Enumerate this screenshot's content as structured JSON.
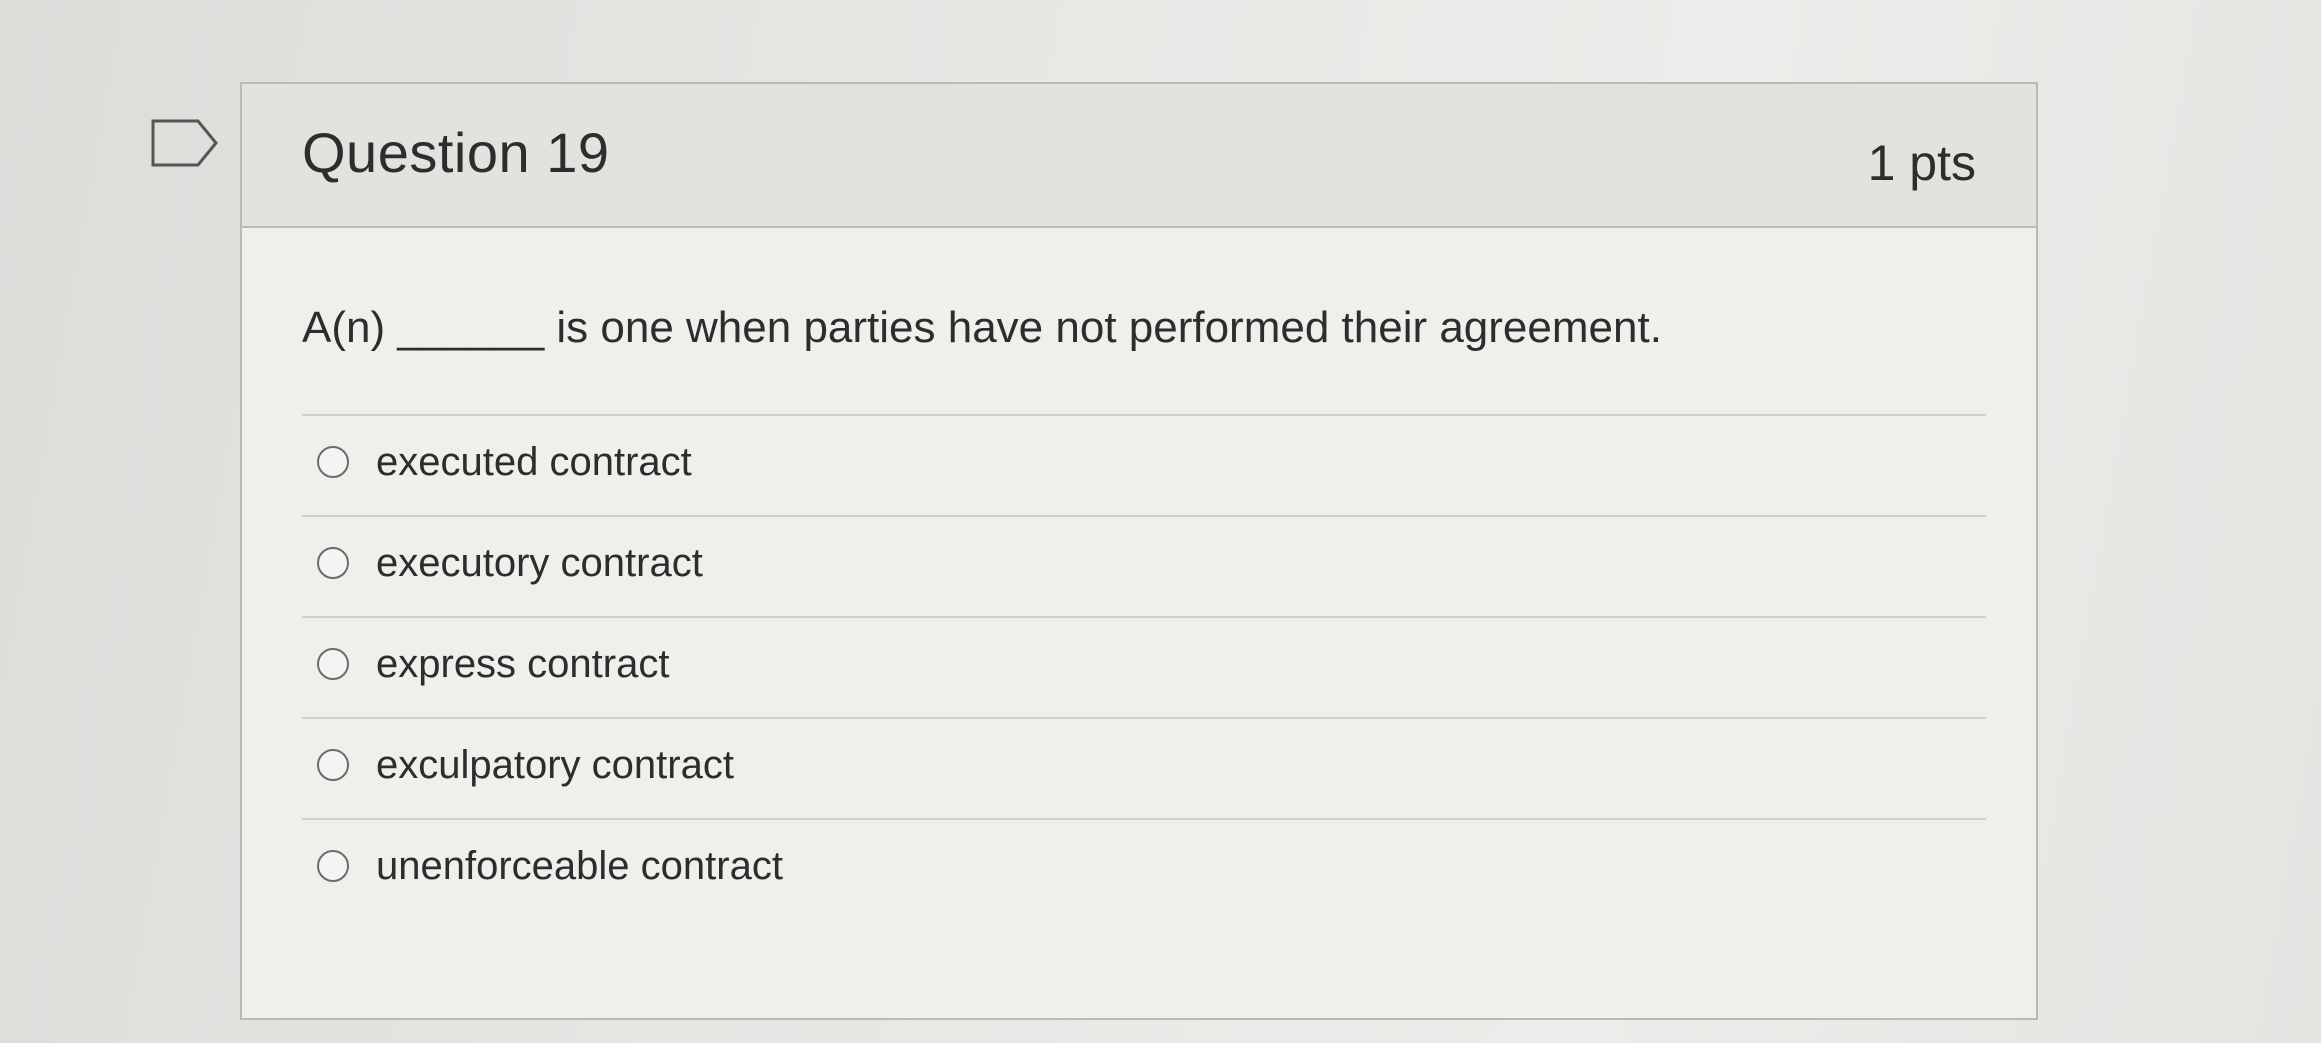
{
  "question": {
    "title": "Question 19",
    "points": "1 pts",
    "text": "A(n) ______ is one when parties have not performed their agreement."
  },
  "flag_icon": "flag-question-icon",
  "answers": [
    {
      "label": "executed contract",
      "selected": false
    },
    {
      "label": "executory contract",
      "selected": false
    },
    {
      "label": "express contract",
      "selected": false
    },
    {
      "label": "exculpatory contract",
      "selected": false
    },
    {
      "label": "unenforceable contract",
      "selected": false
    }
  ]
}
